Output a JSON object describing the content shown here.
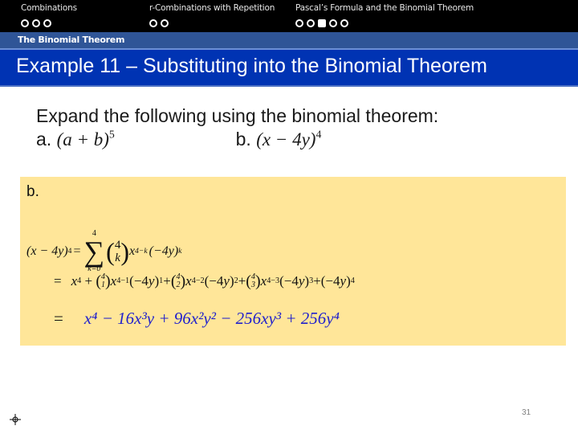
{
  "nav": {
    "sections": [
      {
        "label": "Combinations",
        "dots": [
          false,
          false,
          false
        ]
      },
      {
        "label": "r-Combinations with Repetition",
        "dots": [
          false,
          false
        ]
      },
      {
        "label": "Pascal’s Formula and the Binomial Theorem",
        "dots": [
          false,
          false,
          true,
          false,
          false
        ]
      }
    ],
    "current_section": "The Binomial Theorem"
  },
  "slide": {
    "title": "Example 11 – Substituting into the Binomial Theorem",
    "prompt": "Expand the following using the binomial theorem:",
    "part_a_label": "a.",
    "part_a_expr": "(a + b)",
    "part_a_exp": "5",
    "part_b_label": "b.",
    "part_b_expr": "(x − 4y)",
    "part_b_exp": "4"
  },
  "solution": {
    "label": "b.",
    "lhs": "(x − 4y)",
    "lhs_exp": "4",
    "sum_upper": "4",
    "sum_lower": "k=0",
    "sum_symbol": "∑",
    "binom_top": "4",
    "binom_bottom": "k",
    "term": "x",
    "term_exp": "4−k",
    "factor": "(−4y)",
    "factor_exp": "k",
    "expansion": "= x^4 + C(4,1)x^(4−1)(−4y)^1 + C(4,2)x^(4−2)(−4y)^2 + C(4,3)x^(4−3)(−4y)^3 + (−4y)^4",
    "result": "x⁴ − 16x³y + 96x²y² − 256xy³ + 256y⁴",
    "result_color": "#2222cc"
  },
  "footer": {
    "page_number": "31",
    "nav_icon": "crosshair-icon"
  }
}
